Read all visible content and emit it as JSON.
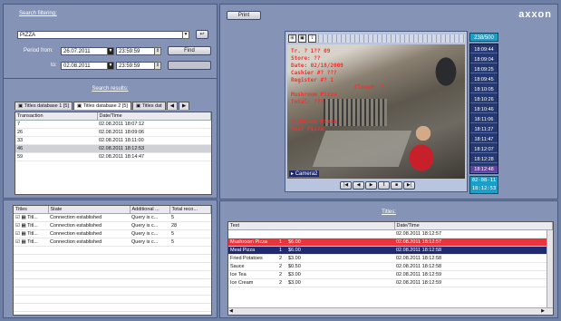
{
  "search": {
    "title": "Search filtering:",
    "query": "PIZZA",
    "period_from_label": "Period from:",
    "from_date": "26.07.2011",
    "from_time": "23:59:59",
    "to_label": "to:",
    "to_date": "02.08.2011",
    "to_time": "23:59:59",
    "find_label": "Find"
  },
  "results": {
    "title": "Search results:",
    "tabs": [
      "Titles database 1 [5]",
      "Titles database 2 [5]",
      "Titles dat"
    ],
    "columns": [
      "Transaction",
      "Date/Time"
    ],
    "rows": [
      [
        "7",
        "02.08.2011 18:07:12"
      ],
      [
        "26",
        "02.08.2011 18:09:06"
      ],
      [
        "33",
        "02.08.2011 18:11:00"
      ],
      [
        "46",
        "02.08.2011 18:12:53"
      ],
      [
        "59",
        "02.08.2011 18:14:47"
      ]
    ]
  },
  "connections": {
    "columns": [
      "Titles",
      "State",
      "Additional ...",
      "Total reco..."
    ],
    "rows": [
      [
        "Titl...",
        "Connection established",
        "Query is c...",
        "5"
      ],
      [
        "Titl...",
        "Connection established",
        "Query is c...",
        "28"
      ],
      [
        "Titl...",
        "Connection established",
        "Query is c...",
        "5"
      ],
      [
        "Titl...",
        "Connection established",
        "Query is c...",
        "5"
      ]
    ]
  },
  "toolbar": {
    "print_label": "Print"
  },
  "brand": {
    "logo": "axxon"
  },
  "video": {
    "frame_counter": "238/500",
    "clock_date": "02-08-11",
    "clock_time": "18:12:53",
    "overlay_lines": [
      "Tr. ? 1?? 09",
      "Store: ??",
      "Date: 02/18/2009",
      "Cashier #? ???",
      "Register #? 1",
      "Closed: ?",
      "Mushroom Pizza",
      "Total: ???",
      "Mushroom Pizza",
      "Meat Pizza"
    ],
    "camera_label": "Camera2",
    "timeline": [
      "18:09:44",
      "18:09:04",
      "18:09:25",
      "18:09:45",
      "18:10:05",
      "18:10:26",
      "18:10:46",
      "18:11:06",
      "18:11:27",
      "18:11:47",
      "18:12:07",
      "18:12:28",
      "18:12:48"
    ]
  },
  "titles": {
    "title": "Titles:",
    "columns": [
      "Text",
      "Date/Time"
    ],
    "rows": [
      {
        "name": "",
        "qty": "",
        "price": "",
        "time": "02.08.2011 18:12:57",
        "hl": ""
      },
      {
        "name": "Mushroom Pizza",
        "qty": "1",
        "price": "$6.00",
        "time": "02.08.2011 18:12:57",
        "hl": "red"
      },
      {
        "name": "Meat Pizza",
        "qty": "1",
        "price": "$6.00",
        "time": "02.08.2011 18:12:58",
        "hl": "blue"
      },
      {
        "name": "Fried Potatoes",
        "qty": "2",
        "price": "$3.00",
        "time": "02.08.2011 18:12:58",
        "hl": ""
      },
      {
        "name": "Sauce",
        "qty": "2",
        "price": "$0.50",
        "time": "02.08.2011 18:12:58",
        "hl": ""
      },
      {
        "name": "Ice Tea",
        "qty": "2",
        "price": "$3.00",
        "time": "02.08.2011 18:12:59",
        "hl": ""
      },
      {
        "name": "Ice Cream",
        "qty": "2",
        "price": "$3.00",
        "time": "02.08.2011 18:12:59",
        "hl": ""
      }
    ]
  },
  "colors": {
    "highlight_red": "#e8343a",
    "highlight_blue": "#202a70",
    "panel": "#8493b6",
    "clock": "#1aa0c8"
  }
}
